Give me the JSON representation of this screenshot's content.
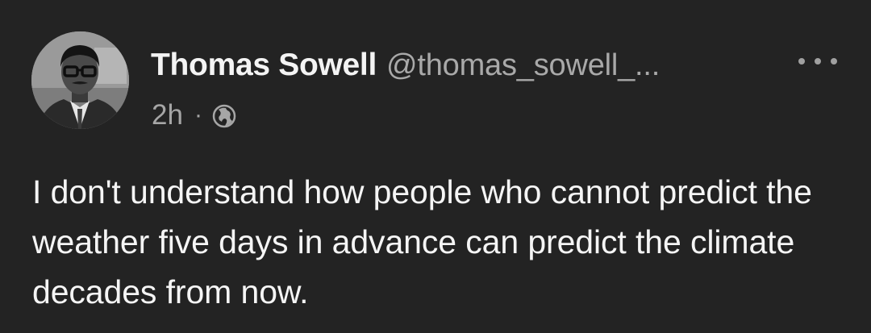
{
  "author": {
    "name": "Thomas Sowell",
    "handle": "@thomas_sowell_..."
  },
  "meta": {
    "time": "2h",
    "separator": "·",
    "visibility_icon": "globe-icon"
  },
  "actions": {
    "more_icon": "more-horizontal-icon"
  },
  "post": {
    "text": "I don't understand how people who cannot predict the weather five days in advance can predict the climate decades from now."
  },
  "colors": {
    "background": "#232323",
    "text_primary": "#f5f5f5",
    "text_secondary": "#a6a6a6"
  }
}
